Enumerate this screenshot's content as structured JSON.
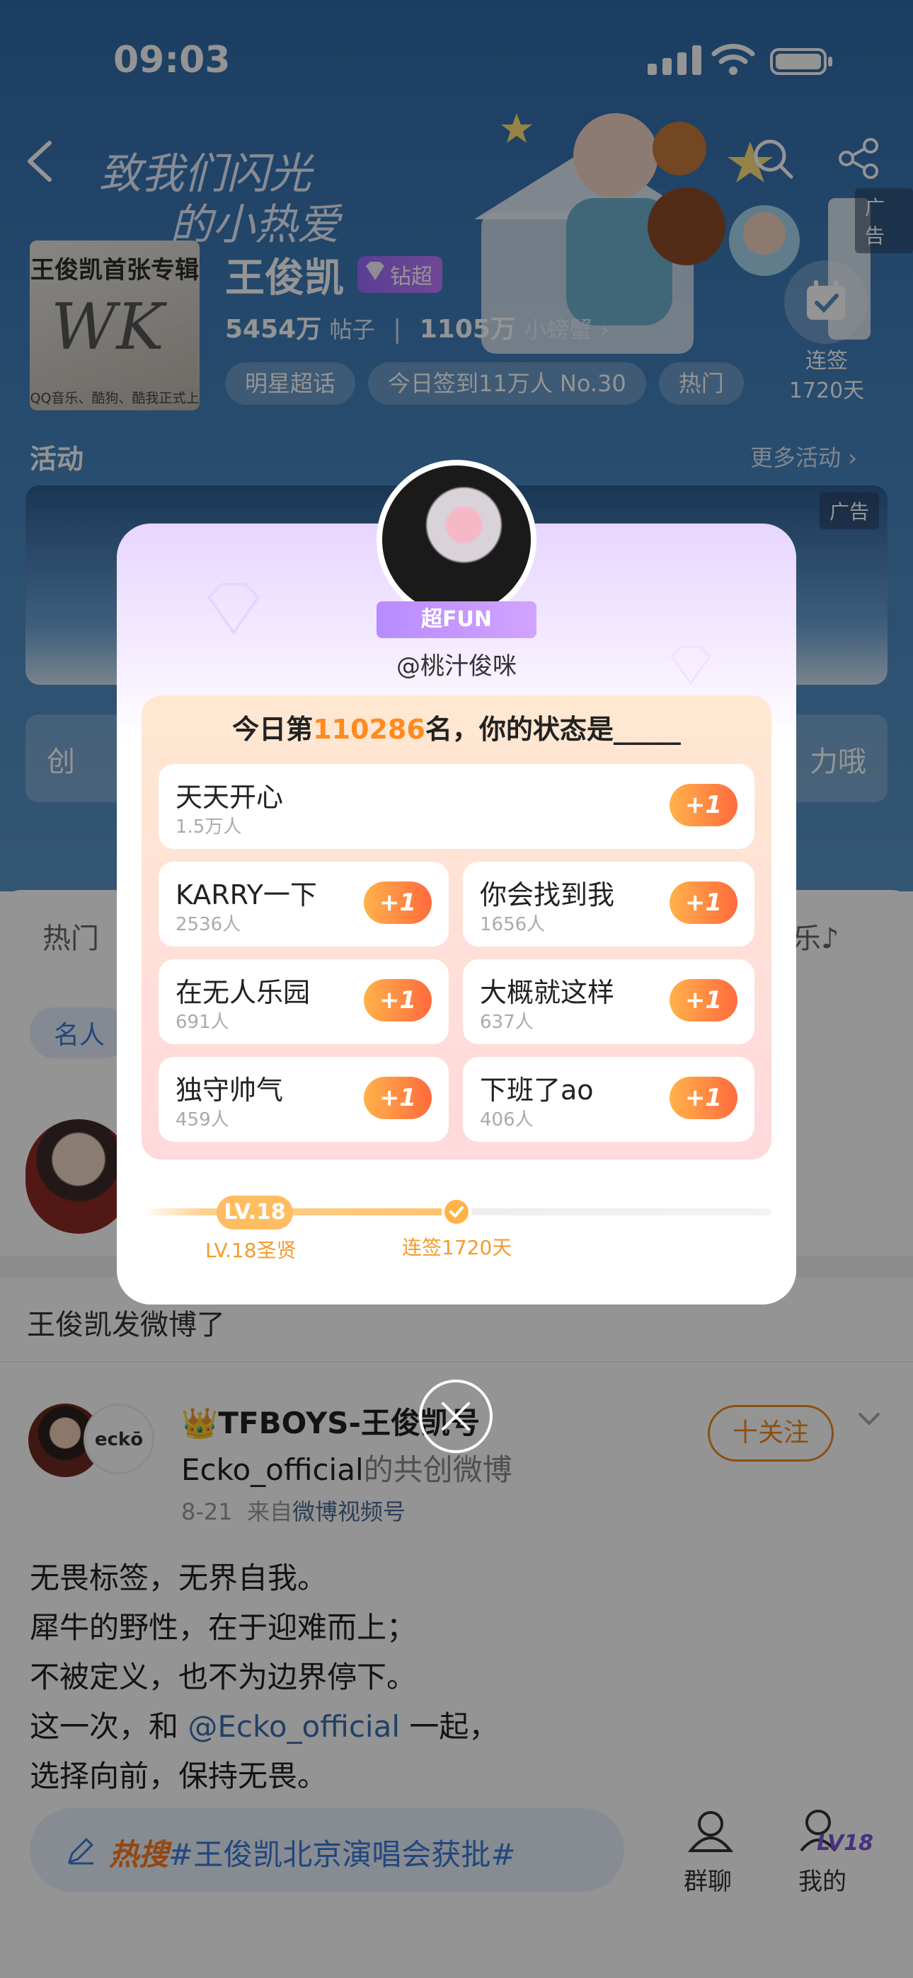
{
  "status": {
    "time": "09:03"
  },
  "header": {
    "handwriting": [
      "致我们闪光",
      "的小热爱"
    ],
    "ad_label": "广告",
    "album": {
      "title": "王俊凯首张专辑",
      "logo": "WK",
      "tagline": "QQ音乐、酷狗、酷我正式上线"
    },
    "name": "王俊凯",
    "badge": "钻超",
    "posts_num": "5454万",
    "posts_unit": "帖子",
    "fans_num": "1105万",
    "fans_unit": "小螃蟹",
    "pills": [
      "明星超话",
      "今日签到11万人 No.30",
      "热门"
    ],
    "checkin_label": "连签",
    "checkin_days": "1720天"
  },
  "activity": {
    "title": "活动",
    "more": "更多活动",
    "ad_label": "广告"
  },
  "creator_row": {
    "left": "创",
    "right": "力哦"
  },
  "tabs": {
    "left": "热门",
    "right": "乐"
  },
  "chip": "名人",
  "feed": {
    "posted": "王俊凯发微博了",
    "author": "TFBOYS-王俊凯",
    "author_suffix": "号",
    "co": "Ecko_official",
    "co_suffix": "的共创微博",
    "date": "8-21",
    "from": "来自",
    "source": "微博视频号",
    "follow": "十关注",
    "partner_logo": "eckō",
    "body": [
      "无畏标签，无界自我。",
      "犀牛的野性，在于迎难而上；",
      "不被定义，也不为边界停下。",
      "这一次，和",
      "@Ecko_official",
      "一起，",
      "选择向前，保持无畏。"
    ]
  },
  "bottom": {
    "hot_tag": "热搜",
    "hashtag": "#王俊凯北京演唱会获批#",
    "group_chat": "群聊",
    "mine": "我的",
    "level": "LV18"
  },
  "popup": {
    "ribbon": "超FUN",
    "user": "@桃汁俊咪",
    "rank_prefix": "今日第",
    "rank_num": "110286",
    "rank_suffix": "名，你的状态是_____",
    "options": [
      {
        "label": "天天开心",
        "count": "1.5万人",
        "plus": "+1"
      },
      {
        "label": "KARRY一下",
        "count": "2536人",
        "plus": "+1"
      },
      {
        "label": "你会找到我",
        "count": "1656人",
        "plus": "+1"
      },
      {
        "label": "在无人乐园",
        "count": "691人",
        "plus": "+1"
      },
      {
        "label": "大概就这样",
        "count": "637人",
        "plus": "+1"
      },
      {
        "label": "独守帅气",
        "count": "459人",
        "plus": "+1"
      },
      {
        "label": "下班了ao",
        "count": "406人",
        "plus": "+1"
      }
    ],
    "level_badge": "LV.18",
    "level_label": "LV.18圣贤",
    "streak_label": "连签1720天"
  },
  "colors": {
    "accent": "#ff8a1e",
    "link": "#3a6fb0",
    "purple": "#b78cff"
  }
}
